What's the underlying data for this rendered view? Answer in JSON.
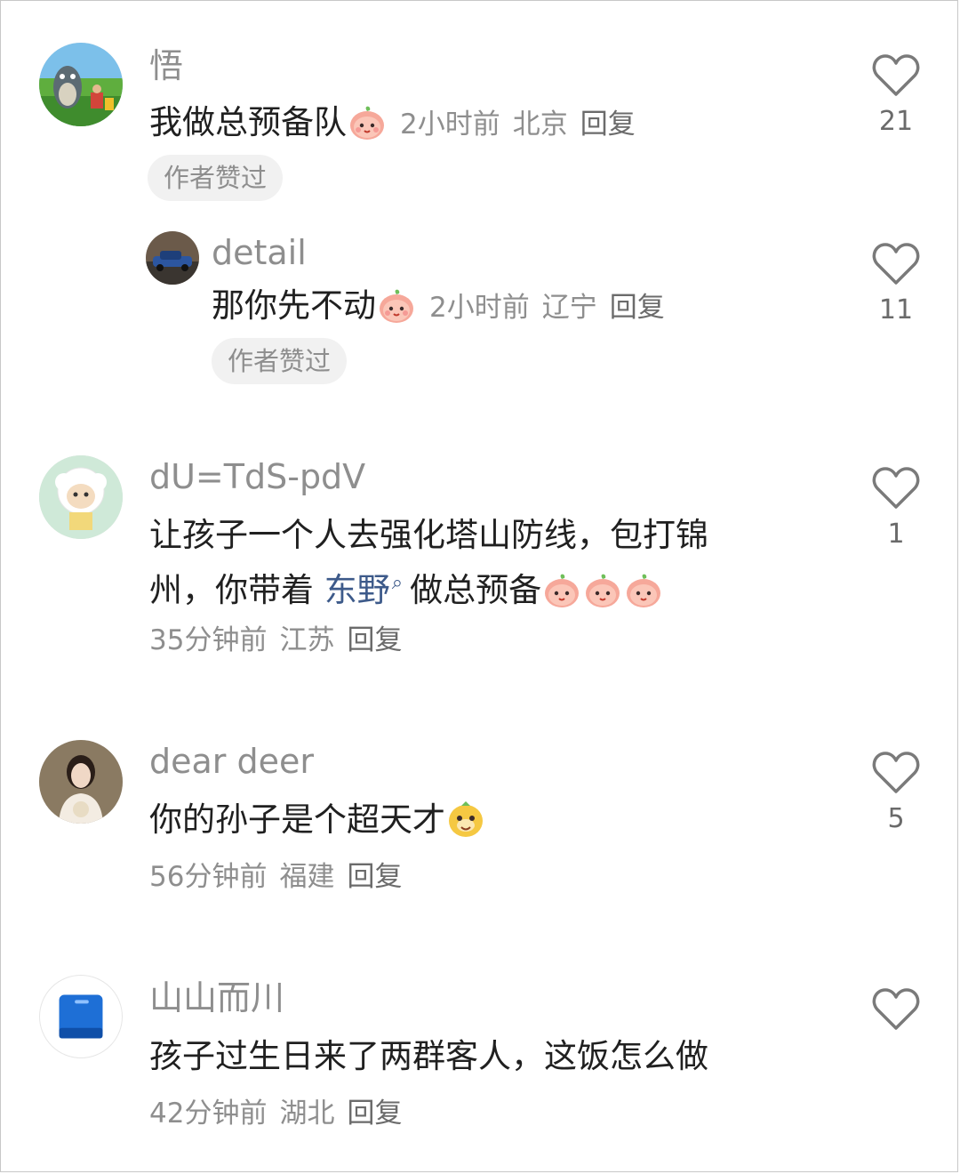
{
  "comments": [
    {
      "name": "悟",
      "text": "我做总预备队",
      "time": "2小时前",
      "location": "北京",
      "reply": "回复",
      "badge": "作者赞过",
      "likes": "21",
      "avatar_icon": "totoro-landscape-avatar"
    },
    {
      "name": "detail",
      "text": "那你先不动",
      "time": "2小时前",
      "location": "辽宁",
      "reply": "回复",
      "badge": "作者赞过",
      "likes": "11",
      "avatar_icon": "car-avatar"
    },
    {
      "name": "dU=TdS-pdV",
      "text_line1": "让孩子一个人去强化塔山防线，包打锦",
      "text_line2_pre": "州，你带着 ",
      "topic": "东野",
      "text_line2_post": "做总预备",
      "time": "35分钟前",
      "location": "江苏",
      "reply": "回复",
      "likes": "1",
      "avatar_icon": "sheep-cartoon-avatar"
    },
    {
      "name": "dear deer",
      "text": "你的孙子是个超天才",
      "time": "56分钟前",
      "location": "福建",
      "reply": "回复",
      "likes": "5",
      "avatar_icon": "woman-portrait-avatar"
    },
    {
      "name": "山山而川",
      "text": "孩子过生日来了两群客人，这饭怎么做",
      "time": "42分钟前",
      "location": "湖北",
      "reply": "回复",
      "likes": "",
      "avatar_icon": "blue-book-avatar"
    }
  ],
  "colors": {
    "name": "#8e8e8e",
    "text": "#202020",
    "topic": "#3d5a8a",
    "badge_bg": "#f1f1f1",
    "heart": "#7a7a7a"
  }
}
